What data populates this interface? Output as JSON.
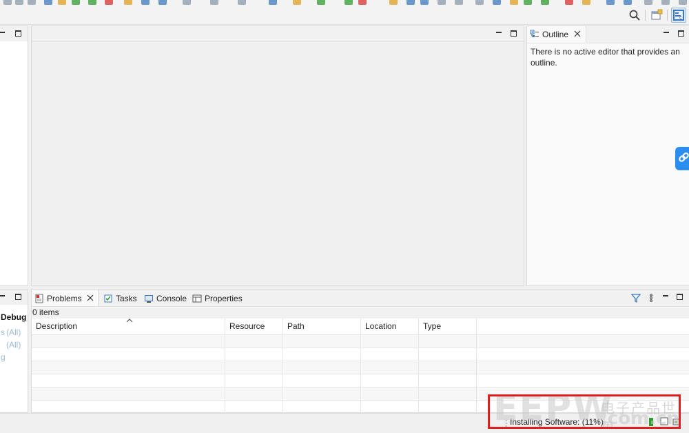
{
  "toolbar": {
    "top_icons": [
      {
        "name": "run-icon",
        "color": "#8a9aa8"
      },
      {
        "name": "save-icon",
        "color": "#8a9aa8"
      },
      {
        "name": "build-icon",
        "color": "#8a9aa8"
      },
      {
        "name": "class-icon",
        "color": "#3b78c2"
      },
      {
        "name": "package-icon",
        "color": "#e0a020"
      },
      {
        "name": "debug-icon",
        "color": "#2e9c2e"
      },
      {
        "name": "run-green-icon",
        "color": "#2e9c2e"
      },
      {
        "name": "stop-red-icon",
        "color": "#d83030"
      },
      {
        "name": "folder-icon",
        "color": "#e0a020"
      },
      {
        "name": "terminal-icon",
        "color": "#3b78c2"
      },
      {
        "name": "magnifier-icon",
        "color": "#3b78c2"
      }
    ]
  },
  "outline": {
    "tab_label": "Outline",
    "message": "There is no active editor that provides an outline."
  },
  "bottom_left": {
    "debug_label": "Debug",
    "dot_label": "s",
    "all_label_1": "(All)",
    "all_label_2": "(All)",
    "g_label": "g"
  },
  "problems": {
    "tabs": [
      {
        "label": "Problems",
        "active": true,
        "icon": "problems-icon"
      },
      {
        "label": "Tasks",
        "active": false,
        "icon": "tasks-icon"
      },
      {
        "label": "Console",
        "active": false,
        "icon": "console-icon"
      },
      {
        "label": "Properties",
        "active": false,
        "icon": "properties-icon"
      }
    ],
    "items_count": "0 items",
    "columns": [
      "Description",
      "Resource",
      "Path",
      "Location",
      "Type"
    ]
  },
  "status": {
    "text": "Installing Software: (11%)",
    "progress_color": "#2e9c2e"
  },
  "watermark": {
    "big": "EEPW",
    "cn": "电子产品世界",
    "domain": ".com.cn"
  }
}
